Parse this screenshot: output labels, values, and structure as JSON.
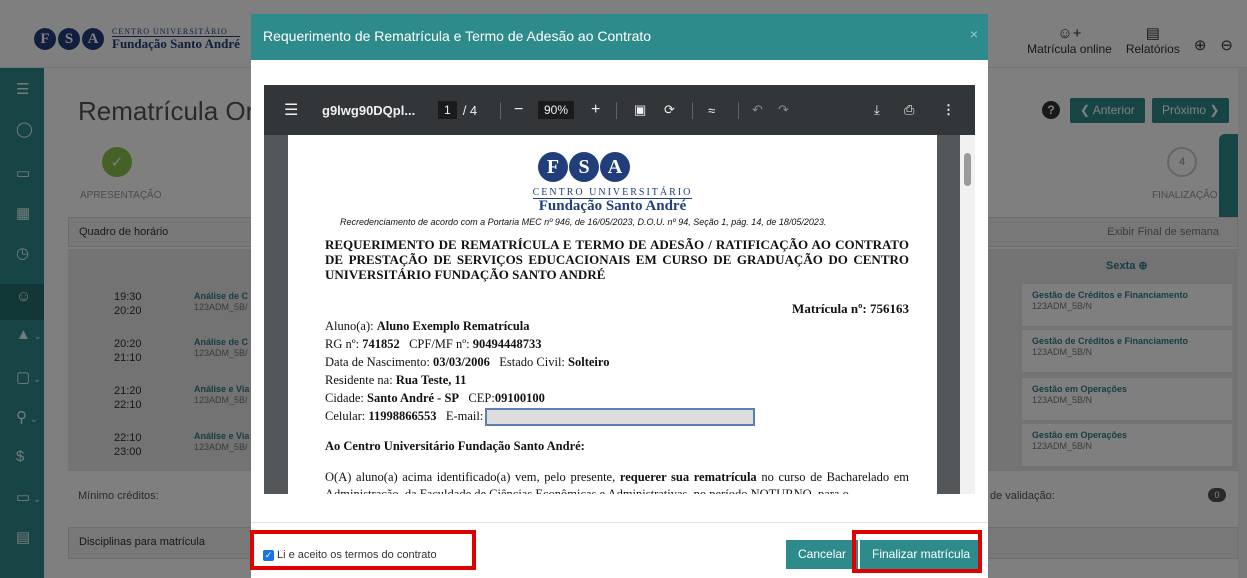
{
  "app": {
    "logo_line1": "CENTRO UNIVERSITÁRIO",
    "logo_line2": "Fundação Santo André",
    "top_actions": {
      "matricula_online": "Matrícula online",
      "relatorios": "Relatórios"
    },
    "page_title": "Rematrícula On-",
    "help": "?",
    "prev_label": "❮ Anterior",
    "next_label": "Próximo ❯",
    "steps": {
      "first_label": "APRESENTAÇÃO",
      "last_label": "FINALIZAÇÃO",
      "last_number": "4"
    },
    "quadro_label": "Quadro de horário",
    "exibir_label": "Exibir Final de semana",
    "sexta_label": "Sexta",
    "schedule": [
      {
        "start": "19:30",
        "end": "20:20",
        "left_name": "Análise de C",
        "left_code": "123ADM_5B/",
        "right_name": "Gestão de Créditos e Financiamento",
        "right_code": "123ADM_5B/N"
      },
      {
        "start": "20:20",
        "end": "21:10",
        "left_name": "Análise de C",
        "left_code": "123ADM_5B/",
        "right_name": "Gestão de Créditos e Financiamento",
        "right_code": "123ADM_5B/N"
      },
      {
        "start": "21:20",
        "end": "22:10",
        "left_name": "Análise e Via",
        "left_code": "123ADM_5B/",
        "right_name": "Gestão em Operações",
        "right_code": "123ADM_5B/N"
      },
      {
        "start": "22:10",
        "end": "23:00",
        "left_name": "Análise e Via",
        "left_code": "123ADM_5B/",
        "right_name": "Gestão em Operações",
        "right_code": "123ADM_5B/N"
      }
    ],
    "min_creditos": "Mínimo créditos:",
    "validacao": "de validação:",
    "validacao_count": "0",
    "disciplinas_label": "Disciplinas para matrícula"
  },
  "modal": {
    "title": "Requerimento de Rematrícula e Termo de Adesão ao Contrato",
    "close": "×",
    "viewer": {
      "filename": "g9lwg90DQpl...",
      "page_current": "1",
      "page_total": "/ 4",
      "zoom": "90%"
    },
    "doc": {
      "logo_letters": [
        "F",
        "S",
        "A"
      ],
      "centro": "CENTRO UNIVERSITÁRIO",
      "fundacao": "Fundação Santo André",
      "recred": "Recredenciamento de acordo com a Portaria MEC nº 946, de 16/05/2023, D.O.U. nº 94, Seção 1, pág. 14, de 18/05/2023.",
      "heading": "REQUERIMENTO DE REMATRÍCULA E TERMO DE ADESÃO / RATIFICAÇÃO AO CONTRATO DE PRESTAÇÃO DE SERVIÇOS EDUCACIONAIS EM CURSO DE GRADUAÇÃO DO CENTRO UNIVERSITÁRIO FUNDAÇÃO SANTO ANDRÉ",
      "matricula": "Matrícula nº: 756163",
      "aluno_label": "Aluno(a): ",
      "aluno": "Aluno Exemplo Rematrícula",
      "rg_label": "RG nº: ",
      "rg": "741852",
      "cpf_label": "CPF/MF nº: ",
      "cpf": "90494448733",
      "nasc_label": "Data de Nascimento: ",
      "nasc": "03/03/2006",
      "civil_label": "Estado Civil: ",
      "civil": "Solteiro",
      "resid_label": "Residente na: ",
      "resid": "Rua Teste, 11",
      "cidade_label": "Cidade: ",
      "cidade": "Santo André - SP",
      "cep_label": "CEP:",
      "cep": "09100100",
      "cel_label": "Celular: ",
      "cel": "11998866553",
      "email_label": "E-mail:",
      "destinatario": "Ao Centro Universitário Fundação Santo André:",
      "body_pre": "O(A) aluno(a) acima identificado(a) vem, pelo presente, ",
      "body_bold": "requerer sua rematrícula",
      "body_post": " no curso de Bacharelado em Administração, da Faculdade de Ciências Econômicas e Administrativas, no período NOTURNO, para o"
    },
    "accept_label": "Li e aceito os termos do contrato",
    "cancel_label": "Cancelar",
    "finalize_label": "Finalizar matrícula"
  },
  "colors": {
    "teal": "#2e8b8b",
    "highlight": "#e00000",
    "brand_blue": "#1f3e7a"
  }
}
